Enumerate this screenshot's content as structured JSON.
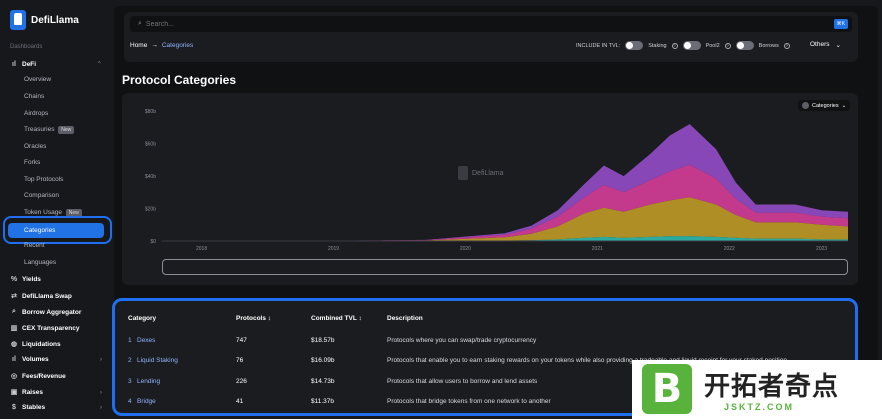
{
  "sidebar": {
    "app_name": "DefiLlama",
    "section_label": "Dashboards",
    "defi_label": "DeFi",
    "defi_sub": [
      "Overview",
      "Chains",
      "Airdrops",
      "Treasuries",
      "Oracles",
      "Forks",
      "Top Protocols",
      "Comparison",
      "Token Usage",
      "Categories",
      "Recent",
      "Languages"
    ],
    "badge_new": "New",
    "bottom_items": [
      {
        "label": "Yields",
        "icon": "percent-icon"
      },
      {
        "label": "DefiLlama Swap",
        "icon": "swap-icon"
      },
      {
        "label": "Borrow Aggregator",
        "icon": "search-icon"
      },
      {
        "label": "CEX Transparency",
        "icon": "building-icon"
      },
      {
        "label": "Liquidations",
        "icon": "drop-icon"
      },
      {
        "label": "Volumes",
        "icon": "bar-chart-icon"
      },
      {
        "label": "Fees/Revenue",
        "icon": "coin-icon"
      },
      {
        "label": "Raises",
        "icon": "wallet-icon"
      },
      {
        "label": "Stables",
        "icon": "dollar-icon"
      }
    ]
  },
  "header": {
    "search_placeholder": "Search...",
    "shortcut": "⌘K",
    "breadcrumb_home": "Home",
    "breadcrumb_sep": "→",
    "breadcrumb_current": "Categories",
    "include_label": "INCLUDE IN TVL:",
    "toggles": [
      "Staking",
      "Pool2",
      "Borrows"
    ],
    "others_label": "Others"
  },
  "page_title": "Protocol Categories",
  "chart": {
    "selector_label": "Categories",
    "watermark": "DefiLlama"
  },
  "chart_data": {
    "type": "area",
    "stacked": true,
    "x_ticks": [
      "2018",
      "2019",
      "2020",
      "2021",
      "2022",
      "2023"
    ],
    "y_ticks": [
      "$0",
      "$20b",
      "$40b",
      "$60b",
      "$80b"
    ],
    "ylim": [
      0,
      85
    ],
    "y_unit": "$b",
    "legend": "top-right dropdown",
    "grid": false,
    "x": [
      2018.0,
      2019.0,
      2020.0,
      2020.6,
      2020.8,
      2021.0,
      2021.2,
      2021.35,
      2021.5,
      2021.7,
      2021.85,
      2022.0,
      2022.2,
      2022.35,
      2022.5,
      2022.8,
      2023.0,
      2023.2
    ],
    "series": [
      {
        "color": "#2ec4b6",
        "values": [
          0,
          0,
          0.1,
          0.3,
          0.5,
          1,
          2,
          2.5,
          2,
          2.5,
          3,
          3,
          2.5,
          2,
          1.5,
          1.5,
          1,
          1
        ]
      },
      {
        "color": "#c9a227",
        "values": [
          0,
          0,
          0.3,
          2,
          4,
          8,
          15,
          18,
          16,
          20,
          22,
          24,
          20,
          14,
          10,
          10,
          9,
          8
        ]
      },
      {
        "color": "#e040a0",
        "values": [
          0,
          0,
          0.2,
          1.5,
          3,
          6,
          10,
          14,
          12,
          15,
          18,
          20,
          16,
          10,
          6,
          6,
          5,
          5
        ]
      },
      {
        "color": "#9b4fd1",
        "values": [
          0,
          0,
          0.1,
          1,
          2,
          4,
          8,
          12,
          10,
          16,
          22,
          25,
          18,
          10,
          5,
          5,
          4,
          4
        ]
      }
    ]
  },
  "table": {
    "headers": [
      "Category",
      "Protocols ↕",
      "Combined TVL ↕",
      "Description"
    ],
    "rows": [
      {
        "rank": "1",
        "name": "Dexes",
        "protocols": "747",
        "tvl": "$18.57b",
        "description": "Protocols where you can swap/trade cryptocurrency"
      },
      {
        "rank": "2",
        "name": "Liquid Staking",
        "protocols": "76",
        "tvl": "$16.09b",
        "description": "Protocols that enable you to earn staking rewards on your tokens while also providing a tradeable and liquid receipt for your staked position"
      },
      {
        "rank": "3",
        "name": "Lending",
        "protocols": "226",
        "tvl": "$14.73b",
        "description": "Protocols that allow users to borrow and lend assets"
      },
      {
        "rank": "4",
        "name": "Bridge",
        "protocols": "41",
        "tvl": "$11.37b",
        "description": "Protocols that bridge tokens from one network to another"
      }
    ]
  },
  "corner_watermark": {
    "title": "开拓者奇点",
    "url": "JSKTZ.COM",
    "letter": "B"
  }
}
